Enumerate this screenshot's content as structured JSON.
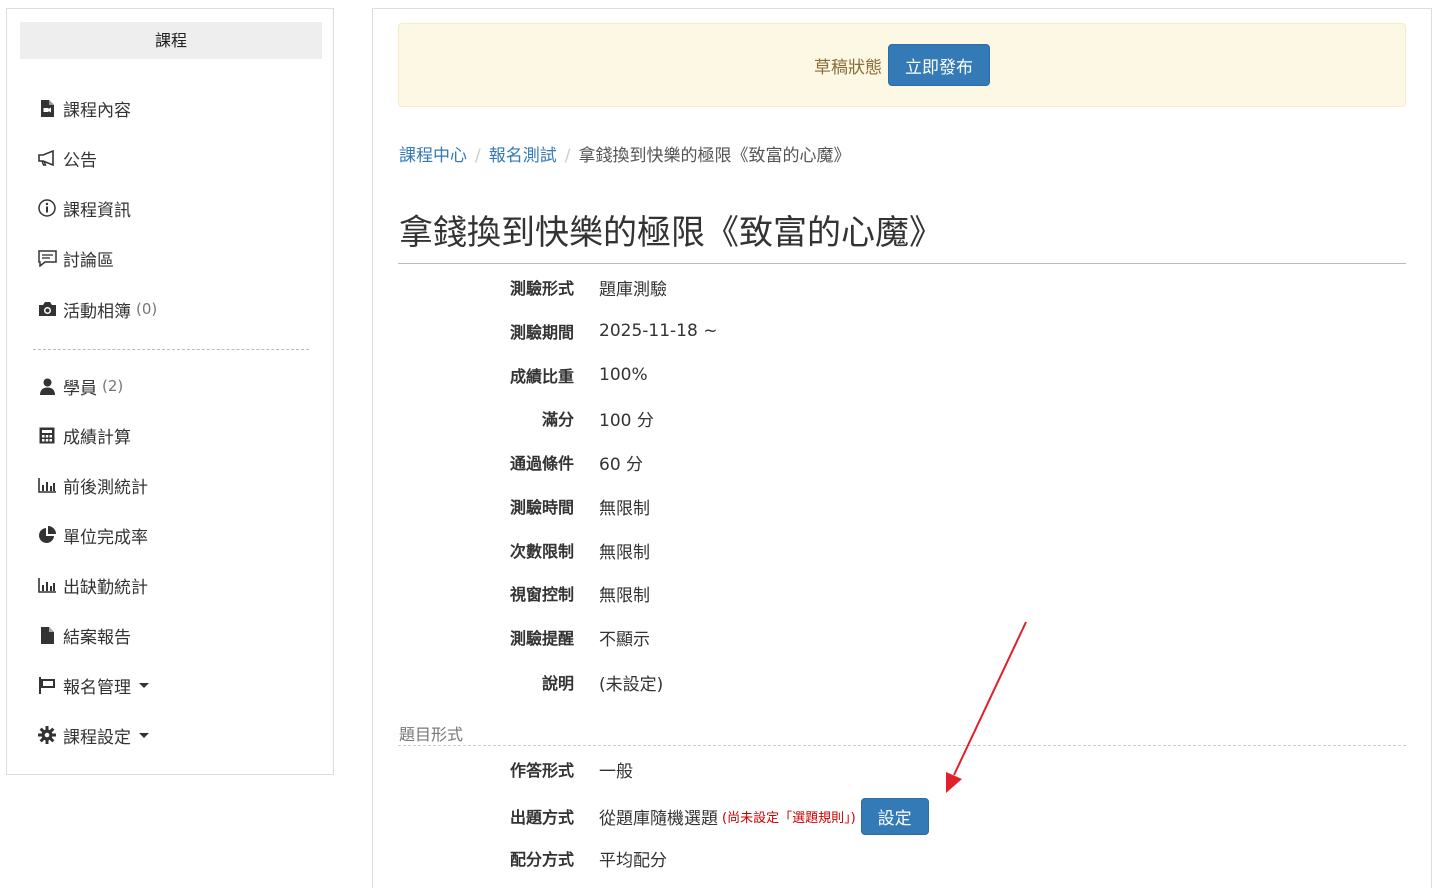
{
  "sidebar": {
    "header": "課程",
    "items": [
      {
        "label": "課程內容",
        "icon": "file-video-icon"
      },
      {
        "label": "公告",
        "icon": "bullhorn-icon"
      },
      {
        "label": "課程資訊",
        "icon": "info-circle-icon"
      },
      {
        "label": "討論區",
        "icon": "comment-icon"
      },
      {
        "label": "活動相簿",
        "icon": "camera-icon",
        "count": "(0)"
      },
      {
        "label": "學員",
        "icon": "user-icon",
        "count": "(2)"
      },
      {
        "label": "成績計算",
        "icon": "calculator-icon"
      },
      {
        "label": "前後測統計",
        "icon": "bar-chart-icon"
      },
      {
        "label": "單位完成率",
        "icon": "pie-chart-icon"
      },
      {
        "label": "出缺勤統計",
        "icon": "bar-chart-icon"
      },
      {
        "label": "結案報告",
        "icon": "file-icon"
      },
      {
        "label": "報名管理",
        "icon": "flag-icon"
      },
      {
        "label": "課程設定",
        "icon": "gear-icon"
      }
    ]
  },
  "draft": {
    "status": "草稿狀態",
    "publish_label": "立即發布"
  },
  "breadcrumb": {
    "home": "課程中心",
    "parent": "報名測試",
    "current": "拿錢換到快樂的極限《致富的心魔》"
  },
  "title": "拿錢換到快樂的極限《致富的心魔》",
  "details": [
    {
      "label": "測驗形式",
      "value": "題庫測驗"
    },
    {
      "label": "測驗期間",
      "value": "2025-11-18 ~"
    },
    {
      "label": "成績比重",
      "value": "100%"
    },
    {
      "label": "滿分",
      "value": "100 分"
    },
    {
      "label": "通過條件",
      "value": "60 分"
    },
    {
      "label": "測驗時間",
      "value": "無限制"
    },
    {
      "label": "次數限制",
      "value": "無限制"
    },
    {
      "label": "視窗控制",
      "value": "無限制"
    },
    {
      "label": "測驗提醒",
      "value": "不顯示"
    },
    {
      "label": "說明",
      "value": "(未設定)"
    }
  ],
  "question_section": {
    "heading": "題目形式",
    "answer_label": "作答形式",
    "answer_value": "一般",
    "method_label": "出題方式",
    "method_value": "從題庫隨機選題",
    "method_warning": "(尚未設定「選題規則」)",
    "set_label": "設定",
    "score_label": "配分方式",
    "score_value": "平均配分"
  },
  "colors": {
    "primary": "#337ab7",
    "warning_bg": "#fcf8e3",
    "warning_text": "#8a6d3b",
    "alert": "#c00000",
    "arrow": "#e0202a"
  }
}
